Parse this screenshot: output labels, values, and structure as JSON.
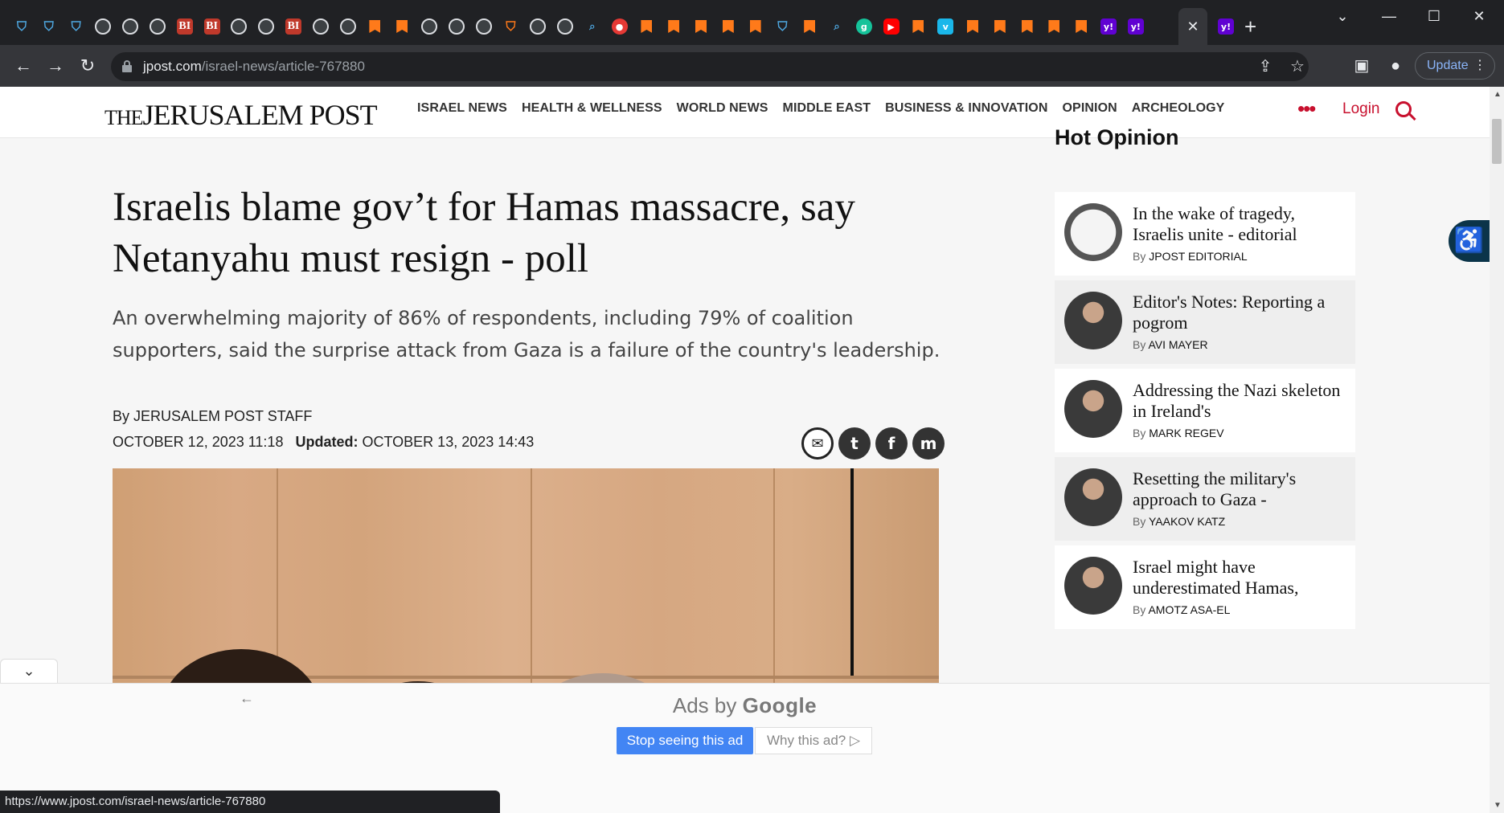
{
  "browser": {
    "tabs": [
      {
        "icon": "shield-icon",
        "glyph": "⛉"
      },
      {
        "icon": "shield-icon",
        "glyph": "⛉"
      },
      {
        "icon": "shield-icon",
        "glyph": "⛉"
      },
      {
        "icon": "globe-icon",
        "glyph": ""
      },
      {
        "icon": "globe-icon",
        "glyph": ""
      },
      {
        "icon": "globe-icon",
        "glyph": ""
      },
      {
        "icon": "bi-icon",
        "glyph": "BI"
      },
      {
        "icon": "bi-icon",
        "glyph": "BI"
      },
      {
        "icon": "globe-icon",
        "glyph": ""
      },
      {
        "icon": "globe-icon",
        "glyph": ""
      },
      {
        "icon": "bi-icon",
        "glyph": "BI"
      },
      {
        "icon": "globe-icon",
        "glyph": ""
      },
      {
        "icon": "globe-icon",
        "glyph": ""
      },
      {
        "icon": "bookmark-icon",
        "glyph": ""
      },
      {
        "icon": "bookmark-icon",
        "glyph": ""
      },
      {
        "icon": "globe-icon",
        "glyph": ""
      },
      {
        "icon": "globe-icon",
        "glyph": ""
      },
      {
        "icon": "globe-icon",
        "glyph": ""
      },
      {
        "icon": "shield-outline-icon",
        "glyph": "⛉"
      },
      {
        "icon": "globe-icon",
        "glyph": ""
      },
      {
        "icon": "globe-icon",
        "glyph": ""
      },
      {
        "icon": "search-icon",
        "glyph": "⌕"
      },
      {
        "icon": "microphone-icon",
        "glyph": "●"
      },
      {
        "icon": "bookmark-icon",
        "glyph": ""
      },
      {
        "icon": "bookmark-icon",
        "glyph": ""
      },
      {
        "icon": "bookmark-icon",
        "glyph": ""
      },
      {
        "icon": "bookmark-icon",
        "glyph": ""
      },
      {
        "icon": "bookmark-icon",
        "glyph": ""
      },
      {
        "icon": "shield-icon",
        "glyph": "⛉"
      },
      {
        "icon": "bookmark-icon",
        "glyph": ""
      },
      {
        "icon": "search-icon",
        "glyph": "⌕"
      },
      {
        "icon": "grammarly-icon",
        "glyph": "g"
      },
      {
        "icon": "youtube-icon",
        "glyph": "▶"
      },
      {
        "icon": "bookmark-icon",
        "glyph": ""
      },
      {
        "icon": "vimeo-icon",
        "glyph": "v"
      },
      {
        "icon": "bookmark-icon",
        "glyph": ""
      },
      {
        "icon": "bookmark-icon",
        "glyph": ""
      },
      {
        "icon": "bookmark-icon",
        "glyph": ""
      },
      {
        "icon": "bookmark-icon",
        "glyph": ""
      },
      {
        "icon": "bookmark-icon",
        "glyph": ""
      },
      {
        "icon": "yahoo-icon",
        "glyph": "y!"
      },
      {
        "icon": "yahoo-icon",
        "glyph": "y!"
      }
    ],
    "active_tab_close": "✕",
    "last_tab_glyph": "y!",
    "new_tab": "+",
    "window": {
      "dropdown": "⌄",
      "minimize": "—",
      "maximize": "☐",
      "close": "✕"
    },
    "nav": {
      "back": "←",
      "forward": "→",
      "reload": "↻"
    },
    "url_domain": "jpost.com",
    "url_path": "/israel-news/article-767880",
    "toolbar_icons": {
      "share": "⇪",
      "bookmark": "☆",
      "sidepanel": "▣",
      "profile": "●"
    },
    "update_label": "Update",
    "menu_dots": "⋮"
  },
  "site": {
    "logo": {
      "the": "THE",
      "name": "JERUSALEM POST"
    },
    "nav": [
      "ISRAEL NEWS",
      "HEALTH & WELLNESS",
      "WORLD NEWS",
      "MIDDLE EAST",
      "BUSINESS & INNOVATION",
      "OPINION",
      "ARCHEOLOGY"
    ],
    "more": "•••",
    "login": "Login"
  },
  "article": {
    "headline": "Israelis blame gov’t for Hamas massacre, say Netanyahu must resign - poll",
    "summary": "An overwhelming majority of 86% of respondents, including 79% of coalition supporters, said the surprise attack from Gaza is a failure of the country's leadership.",
    "byline_prefix": "By ",
    "author": "JERUSALEM POST STAFF",
    "published": "OCTOBER 12, 2023 11:18",
    "updated_label": "Updated:",
    "updated": "OCTOBER 13, 2023 14:43",
    "share": {
      "mail": "✉",
      "twitter": "t",
      "facebook": "f",
      "messenger": "m"
    }
  },
  "sidebar": {
    "title": "Hot Opinion",
    "by_prefix": "By",
    "items": [
      {
        "title": "In the wake of tragedy, Israelis unite - editorial",
        "author": "JPOST EDITORIAL"
      },
      {
        "title": "Editor's Notes: Reporting a pogrom",
        "author": "AVI MAYER"
      },
      {
        "title": "Addressing the Nazi skeleton in Ireland's",
        "author": "MARK REGEV"
      },
      {
        "title": "Resetting the military's approach to Gaza -",
        "author": "YAAKOV KATZ"
      },
      {
        "title": "Israel might have underestimated Hamas,",
        "author": "AMOTZ ASA-EL"
      }
    ]
  },
  "accessibility_glyph": "♿",
  "ad": {
    "collapse": "⌄",
    "back": "←",
    "ads_by": "Ads by ",
    "google": "Google",
    "stop": "Stop seeing this ad",
    "why": "Why this ad? ▷"
  },
  "status_url": "https://www.jpost.com/israel-news/article-767880",
  "colors": {
    "brand": "#c8102e",
    "chrome_dark": "#202124",
    "chrome_toolbar": "#35363a",
    "ad_button": "#4285f4"
  }
}
